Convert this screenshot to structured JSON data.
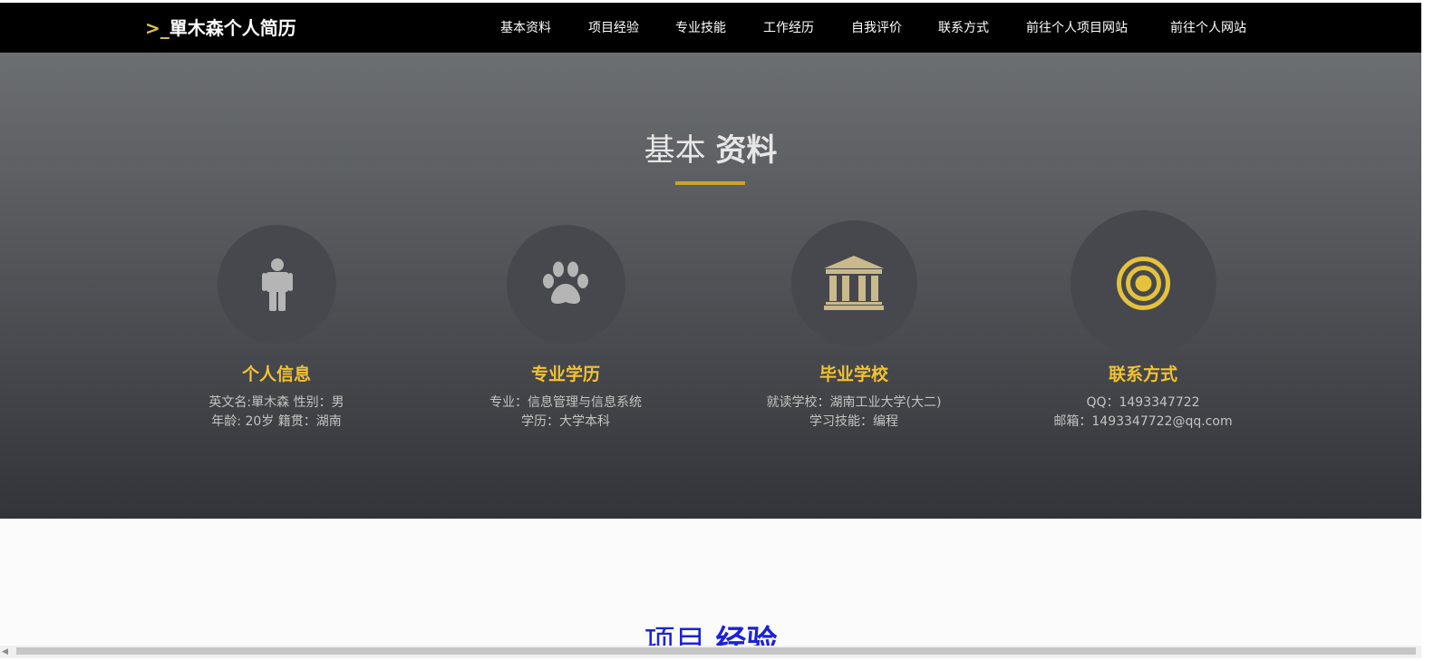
{
  "navbar": {
    "brand_prompt": ">_",
    "brand_title": "單木森个人简历",
    "items": [
      {
        "label": "基本资料"
      },
      {
        "label": "项目经验"
      },
      {
        "label": "专业技能"
      },
      {
        "label": "工作经历"
      },
      {
        "label": "自我评价"
      },
      {
        "label": "联系方式"
      },
      {
        "label": "前往个人项目网站"
      },
      {
        "label": "前往个人网站"
      }
    ]
  },
  "basic_info": {
    "title_light": "基本 ",
    "title_bold": "资料",
    "cards": [
      {
        "icon": "person-icon",
        "title": "个人信息",
        "line1": "英文名:單木森 性别：男",
        "line2": "年龄: 20岁 籍贯：湖南"
      },
      {
        "icon": "paw-icon",
        "title": "专业学历",
        "line1": "专业：信息管理与信息系统",
        "line2": "学历：大学本科"
      },
      {
        "icon": "institution-icon",
        "title": "毕业学校",
        "line1": "就读学校：湖南工业大学(大二)",
        "line2": "学习技能：编程"
      },
      {
        "icon": "target-icon",
        "title": "联系方式",
        "line1": "QQ：1493347722",
        "line2": "邮箱：1493347722@qq.com"
      }
    ]
  },
  "projects": {
    "title_light": "项目 ",
    "title_bold": "经验"
  },
  "colors": {
    "navbar_bg": "#000000",
    "accent": "#f1c232",
    "link_blue": "#1b22d8"
  }
}
